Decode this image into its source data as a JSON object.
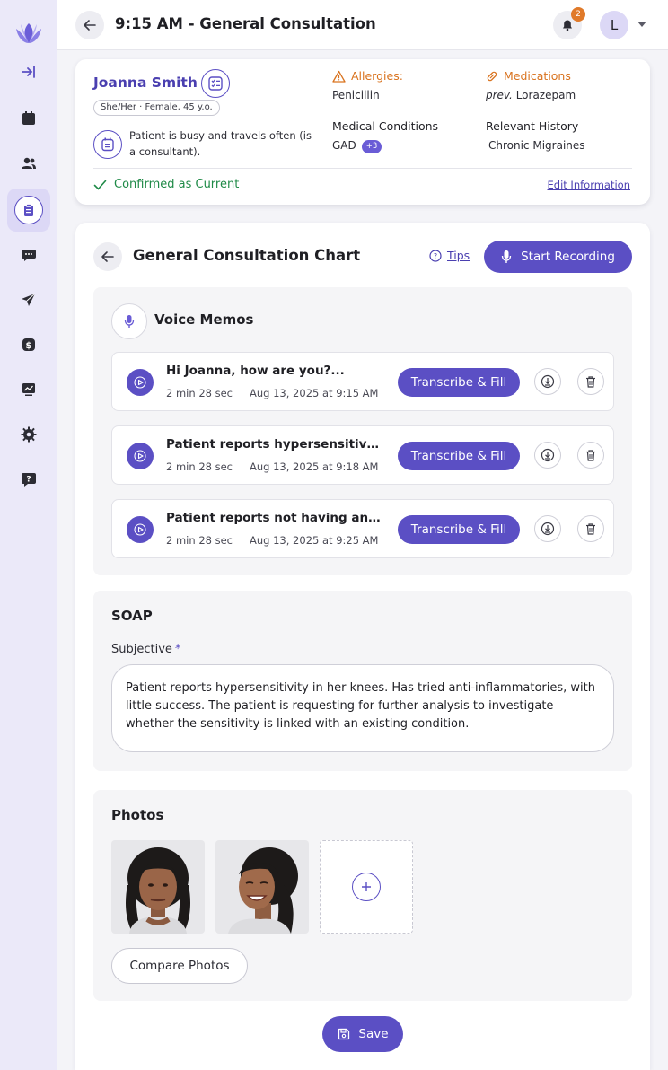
{
  "header": {
    "title": "9:15 AM - General Consultation",
    "notification_count": "2",
    "avatar_initial": "L"
  },
  "sidebar": {
    "items": [
      {
        "name": "collapse",
        "icon": "collapse-arrow-icon"
      },
      {
        "name": "calendar",
        "icon": "calendar-icon"
      },
      {
        "name": "patients",
        "icon": "users-icon"
      },
      {
        "name": "charts",
        "icon": "clipboard-icon",
        "active": true
      },
      {
        "name": "messages",
        "icon": "chat-icon"
      },
      {
        "name": "send",
        "icon": "paper-plane-icon"
      },
      {
        "name": "billing",
        "icon": "dollar-icon"
      },
      {
        "name": "analytics",
        "icon": "chart-icon"
      },
      {
        "name": "settings",
        "icon": "gear-icon"
      },
      {
        "name": "help",
        "icon": "help-icon"
      }
    ]
  },
  "patient": {
    "name": "Joanna Smith",
    "demographics": "She/Her · Female, 45 y.o.",
    "note": "Patient is busy and travels often (is a consultant).",
    "allergies_label": "Allergies:",
    "allergies": "Penicillin",
    "medications_label": "Medications",
    "medications_prefix": "prev.",
    "medications": "Lorazepam",
    "conditions_label": "Medical Conditions",
    "conditions": "GAD",
    "conditions_more": "+3",
    "history_label": "Relevant History",
    "history": "Chronic Migraines",
    "confirmed": "Confirmed as Current",
    "edit_link": "Edit Information"
  },
  "chart": {
    "title": "General Consultation Chart",
    "tips": "Tips",
    "start_recording": "Start Recording"
  },
  "voice_memos": {
    "title": "Voice Memos",
    "transcribe_label": "Transcribe & Fill",
    "items": [
      {
        "title": "Hi Joanna, how are you?...",
        "duration": "2 min 28 sec",
        "date": "Aug 13, 2025 at 9:15 AM"
      },
      {
        "title": "Patient reports hypersensitivity in her knees",
        "duration": "2 min 28 sec",
        "date": "Aug 13, 2025 at 9:18 AM"
      },
      {
        "title": "Patient reports not having any...",
        "duration": "2 min 28 sec",
        "date": "Aug 13, 2025 at 9:25 AM"
      }
    ]
  },
  "soap": {
    "title": "SOAP",
    "subjective_label": "Subjective",
    "required_mark": "*",
    "subjective_text": "Patient reports hypersensitivity in her knees. Has tried anti-inflammatories, with little success. The patient is requesting for further analysis to investigate whether the sensitivity is linked with an existing condition."
  },
  "photos": {
    "title": "Photos",
    "compare_label": "Compare Photos"
  },
  "save_label": "Save",
  "colors": {
    "accent": "#5b4fc4",
    "sidebar_bg": "#ebe9f9",
    "allergy_orange": "#d9731f",
    "confirmed_green": "#1f8a47"
  }
}
